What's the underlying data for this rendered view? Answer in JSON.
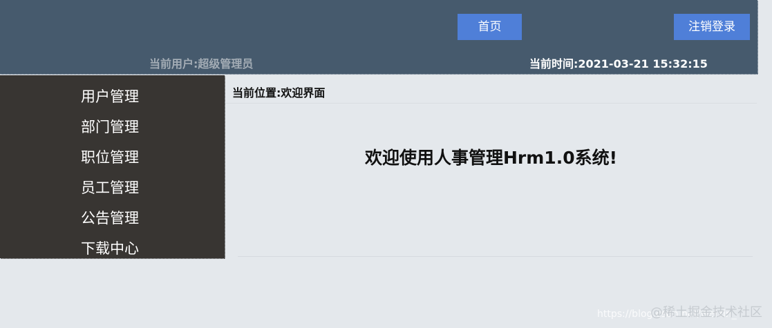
{
  "header": {
    "home_label": "首页",
    "logout_label": "注销登录",
    "current_user": "当前用户:超级管理员",
    "current_time": "当前时间:2021-03-21 15:32:15"
  },
  "sidebar": {
    "items": [
      {
        "label": "用户管理"
      },
      {
        "label": "部门管理"
      },
      {
        "label": "职位管理"
      },
      {
        "label": "员工管理"
      },
      {
        "label": "公告管理"
      },
      {
        "label": "下载中心"
      }
    ]
  },
  "main": {
    "location": "当前位置:欢迎界面",
    "welcome": "欢迎使用人事管理Hrm1.0系统!"
  },
  "watermark": {
    "url": "https://blog.csdn.net/weixin_",
    "brand": "@稀土掘金技术社区"
  }
}
